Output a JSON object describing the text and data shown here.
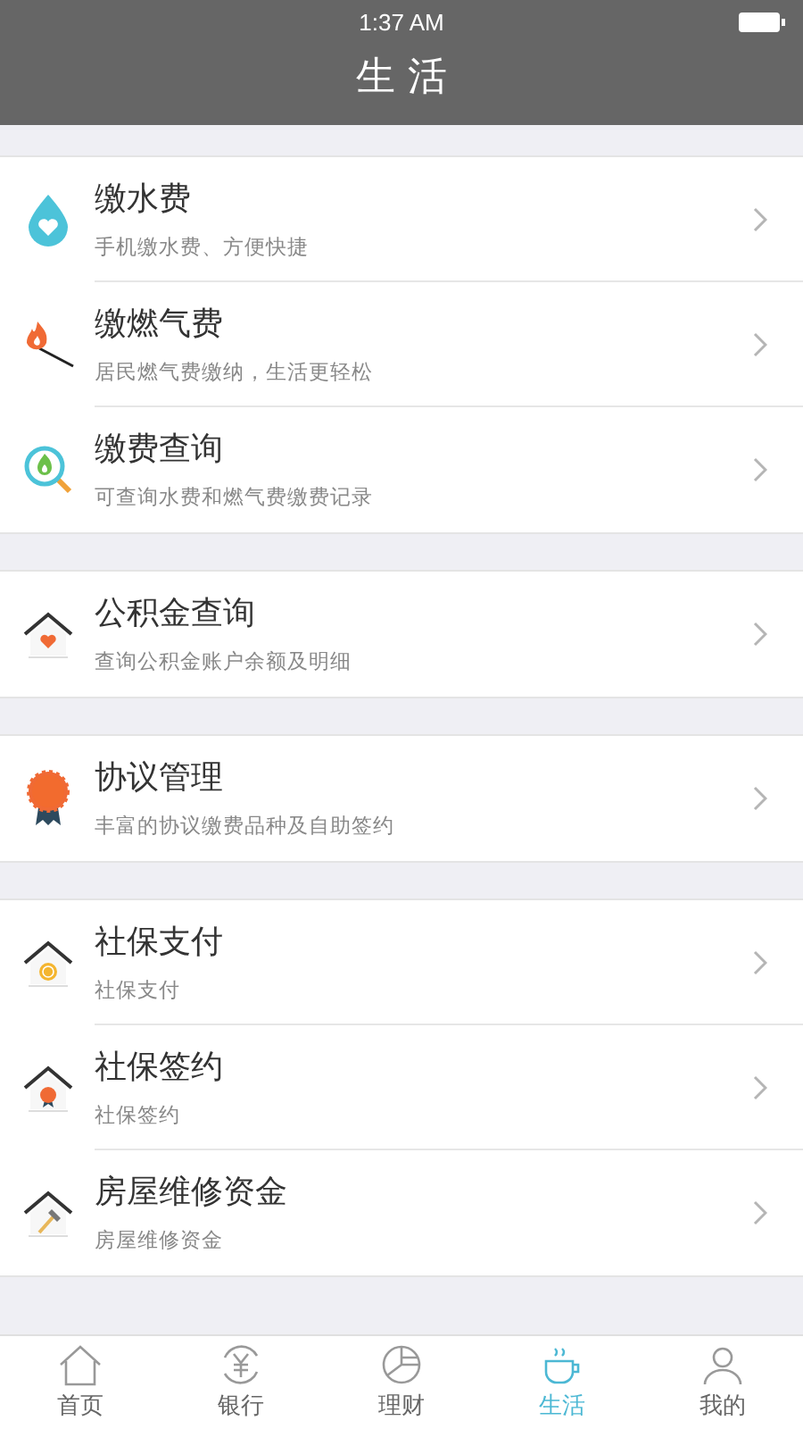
{
  "status_bar": {
    "time": "1:37 AM"
  },
  "nav_bar": {
    "title": "生 活"
  },
  "groups": [
    [
      {
        "title": "缴水费",
        "subtitle": "手机缴水费、方便快捷"
      },
      {
        "title": "缴燃气费",
        "subtitle": "居民燃气费缴纳，生活更轻松"
      },
      {
        "title": "缴费查询",
        "subtitle": "可查询水费和燃气费缴费记录"
      }
    ],
    [
      {
        "title": "公积金查询",
        "subtitle": "查询公积金账户余额及明细"
      }
    ],
    [
      {
        "title": "协议管理",
        "subtitle": "丰富的协议缴费品种及自助签约"
      }
    ],
    [
      {
        "title": "社保支付",
        "subtitle": "社保支付"
      },
      {
        "title": "社保签约",
        "subtitle": "社保签约"
      },
      {
        "title": "房屋维修资金",
        "subtitle": "房屋维修资金"
      }
    ]
  ],
  "tab_bar": [
    {
      "label": "首页",
      "selected": false
    },
    {
      "label": "银行",
      "selected": false
    },
    {
      "label": "理财",
      "selected": false
    },
    {
      "label": "生活",
      "selected": true
    },
    {
      "label": "我的",
      "selected": false
    }
  ]
}
